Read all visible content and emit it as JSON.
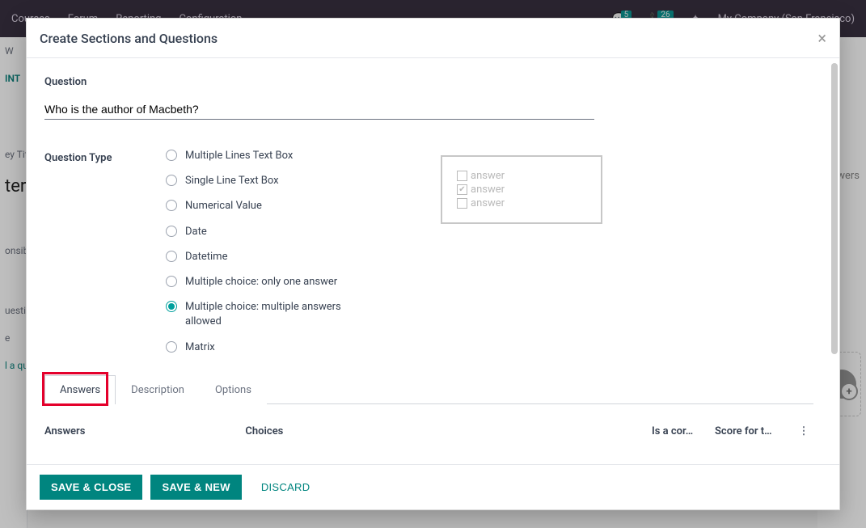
{
  "background": {
    "nav": {
      "courses": "Courses",
      "forum": "Forum",
      "reporting": "Reporting",
      "configuration": "Configuration"
    },
    "badges": {
      "msg": "5",
      "call": "26"
    },
    "company": "My Company (San Francisco)",
    "left_fragments": {
      "w": "W",
      "int": "INT",
      "title": "ey Tit",
      "ter": "ter",
      "resp": "onsibl",
      "quest": "uestio",
      "e": "e",
      "addq": "l a qu"
    },
    "right_label": "wers"
  },
  "modal": {
    "title": "Create Sections and Questions",
    "question_label": "Question",
    "question_value": "Who is the author of Macbeth?",
    "qtype_label": "Question Type",
    "qtypes": [
      {
        "key": "multi_text",
        "label": "Multiple Lines Text Box",
        "selected": false
      },
      {
        "key": "single_text",
        "label": "Single Line Text Box",
        "selected": false
      },
      {
        "key": "numerical",
        "label": "Numerical Value",
        "selected": false
      },
      {
        "key": "date",
        "label": "Date",
        "selected": false
      },
      {
        "key": "datetime",
        "label": "Datetime",
        "selected": false
      },
      {
        "key": "mc_one",
        "label": "Multiple choice: only one answer",
        "selected": false
      },
      {
        "key": "mc_multi",
        "label": "Multiple choice: multiple answers allowed",
        "selected": true
      },
      {
        "key": "matrix",
        "label": "Matrix",
        "selected": false
      }
    ],
    "preview": {
      "opt1": "answer",
      "opt2": "answer",
      "opt3": "answer"
    },
    "tabs": {
      "answers": "Answers",
      "description": "Description",
      "options": "Options",
      "active": "answers"
    },
    "answers_section_label": "Answers",
    "columns": {
      "choices": "Choices",
      "is_correct": "Is a cor…",
      "score": "Score for t…",
      "menu_glyph": "⋮"
    },
    "footer": {
      "save_close": "SAVE & CLOSE",
      "save_new": "SAVE & NEW",
      "discard": "DISCARD"
    }
  }
}
